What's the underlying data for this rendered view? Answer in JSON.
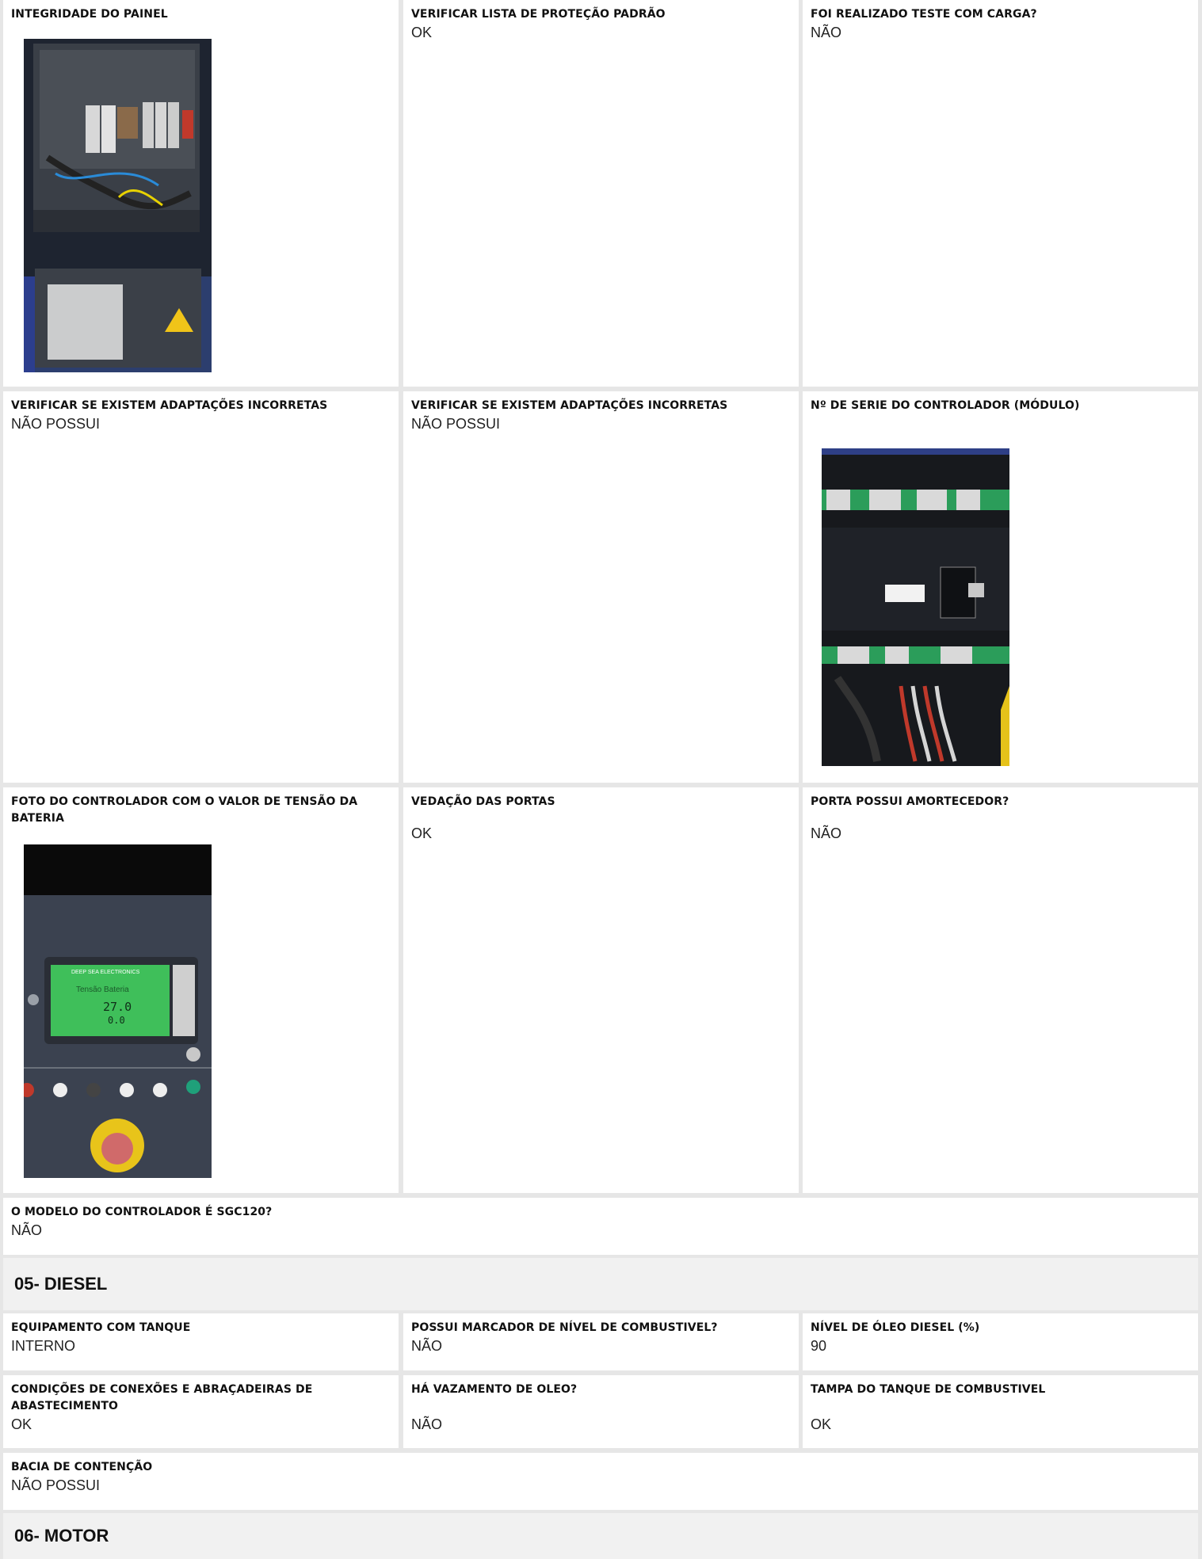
{
  "sections": {
    "diesel": "05- DIESEL",
    "motor": "06- MOTOR"
  },
  "fields": {
    "integridade_painel": {
      "label": "INTEGRIDADE DO PAINEL"
    },
    "lista_protecao": {
      "label": "VERIFICAR LISTA DE PROTEÇÃO PADRÃO",
      "value": "OK"
    },
    "teste_carga": {
      "label": "FOI REALIZADO TESTE COM CARGA?",
      "value": "NÃO"
    },
    "adaptacoes_1": {
      "label": "VERIFICAR SE EXISTEM ADAPTAÇÕES INCORRETAS",
      "value": "NÃO POSSUI"
    },
    "adaptacoes_2": {
      "label": "VERIFICAR SE EXISTEM ADAPTAÇÕES INCORRETAS",
      "value": "NÃO POSSUI"
    },
    "serie_controlador": {
      "label": "Nº DE SERIE DO CONTROLADOR (MÓDULO)"
    },
    "foto_tensao": {
      "label": "FOTO DO CONTROLADOR COM O VALOR DE TENSÃO DA BATERIA"
    },
    "vedacao_portas": {
      "label": "VEDAÇÃO DAS PORTAS",
      "value": "OK"
    },
    "amortecedor": {
      "label": "PORTA POSSUI AMORTECEDOR?",
      "value": "NÃO"
    },
    "modelo_sgc120": {
      "label": "O MODELO DO CONTROLADOR É SGC120?",
      "value": "NÃO"
    },
    "tanque": {
      "label": "EQUIPAMENTO COM TANQUE",
      "value": "INTERNO"
    },
    "marcador_nivel": {
      "label": "POSSUI MARCADOR DE NÍVEL DE COMBUSTIVEL?",
      "value": "NÃO"
    },
    "nivel_diesel": {
      "label": "NÍVEL DE ÓLEO DIESEL (%)",
      "value": "90"
    },
    "conexoes": {
      "label": "CONDIÇÕES DE CONEXÕES E ABRAÇADEIRAS DE ABASTECIMENTO",
      "value": "OK"
    },
    "vazamento": {
      "label": "HÁ VAZAMENTO DE OLEO?",
      "value": "NÃO"
    },
    "tampa_tanque": {
      "label": "TAMPA DO TANQUE DE COMBUSTIVEL",
      "value": "OK"
    },
    "bacia": {
      "label": "BACIA DE CONTENÇÃO",
      "value": "NÃO POSSUI"
    }
  },
  "photo_text": {
    "brand": "DEEP SEA ELECTRONICS",
    "screen_title": "Tensão Bateria",
    "battery_value": "27.0",
    "charge_value": "0.0"
  },
  "colors": {
    "page_gap": "#e6e6e6",
    "cell_bg": "#ffffff",
    "section_bg": "#f1f1f1",
    "lcd_green": "#3fbf5a"
  }
}
